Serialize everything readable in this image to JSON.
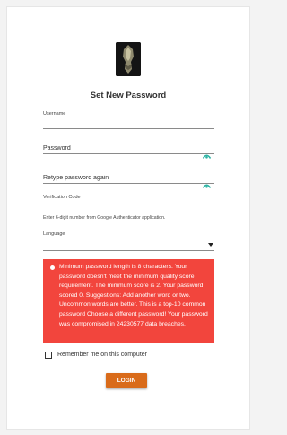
{
  "header": {
    "title": "Set New Password"
  },
  "form": {
    "username_label": "Username",
    "password_placeholder": "Password",
    "retype_placeholder": "Retype password again",
    "verification_label": "Verification Code",
    "verification_hint": "Enter 6-digit number from Google Authenticator application.",
    "language_label": "Language",
    "language_value": "",
    "remember_label": "Remember me on this computer",
    "login_label": "LOGIN"
  },
  "alert": {
    "message": "Minimum password length is 8 characters. Your password doesn't meet the minimum quality score requirement. The minimum score is 2. Your password scored 0. Suggestions: Add another word or two. Uncommon words are better. This is a top-10 common password Choose a different password! Your password was compromised in 24230577 data breaches.",
    "color": "#f2453d"
  },
  "icons": {
    "logo": "app-logo",
    "password_toggle": "eye-icon",
    "retype_toggle": "eye-icon",
    "language_dropdown": "chevron-down-icon",
    "alert": "alert-dot-icon"
  },
  "colors": {
    "accent": "#d96b1a",
    "eye": "#2bb3a3"
  }
}
